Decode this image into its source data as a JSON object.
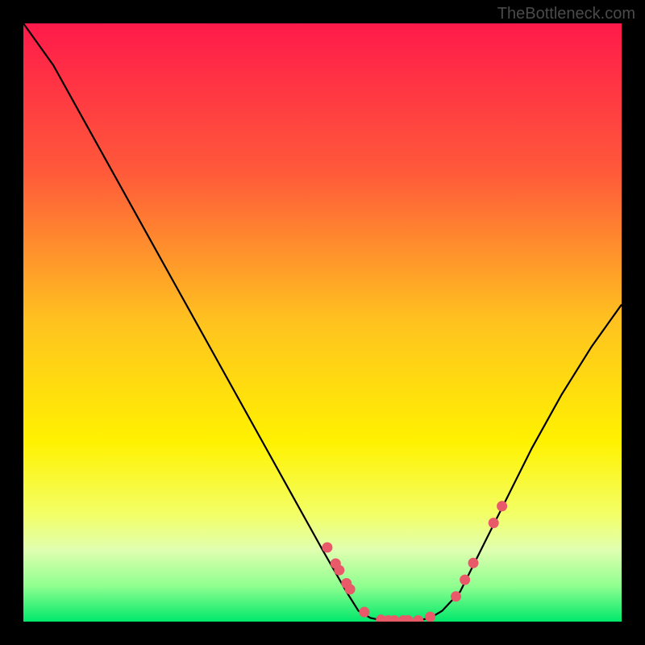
{
  "watermark": "TheBottleneck.com",
  "chart_data": {
    "type": "line",
    "title": "",
    "xlabel": "",
    "ylabel": "",
    "xlim": [
      0,
      100
    ],
    "ylim": [
      0,
      100
    ],
    "curve": [
      {
        "x": 0,
        "y": 100
      },
      {
        "x": 5,
        "y": 93
      },
      {
        "x": 10,
        "y": 84
      },
      {
        "x": 15,
        "y": 75
      },
      {
        "x": 20,
        "y": 66
      },
      {
        "x": 25,
        "y": 57
      },
      {
        "x": 30,
        "y": 48
      },
      {
        "x": 35,
        "y": 39
      },
      {
        "x": 40,
        "y": 30
      },
      {
        "x": 45,
        "y": 21
      },
      {
        "x": 50,
        "y": 12
      },
      {
        "x": 54,
        "y": 5
      },
      {
        "x": 56,
        "y": 1.8
      },
      {
        "x": 58,
        "y": 0.6
      },
      {
        "x": 60,
        "y": 0.2
      },
      {
        "x": 62,
        "y": 0.2
      },
      {
        "x": 64,
        "y": 0.2
      },
      {
        "x": 66,
        "y": 0.2
      },
      {
        "x": 68,
        "y": 0.6
      },
      {
        "x": 70,
        "y": 1.8
      },
      {
        "x": 73,
        "y": 5
      },
      {
        "x": 77,
        "y": 13
      },
      {
        "x": 81,
        "y": 21
      },
      {
        "x": 85,
        "y": 29
      },
      {
        "x": 90,
        "y": 38
      },
      {
        "x": 95,
        "y": 46
      },
      {
        "x": 100,
        "y": 53
      }
    ],
    "dots": [
      {
        "x": 50.8,
        "y": 12.4
      },
      {
        "x": 52.2,
        "y": 9.7
      },
      {
        "x": 52.8,
        "y": 8.6
      },
      {
        "x": 54.0,
        "y": 6.4
      },
      {
        "x": 54.6,
        "y": 5.4
      },
      {
        "x": 57.0,
        "y": 1.6
      },
      {
        "x": 59.8,
        "y": 0.3
      },
      {
        "x": 61.0,
        "y": 0.2
      },
      {
        "x": 62.0,
        "y": 0.2
      },
      {
        "x": 63.5,
        "y": 0.2
      },
      {
        "x": 64.3,
        "y": 0.2
      },
      {
        "x": 66.0,
        "y": 0.2
      },
      {
        "x": 68.0,
        "y": 0.8
      },
      {
        "x": 72.3,
        "y": 4.2
      },
      {
        "x": 73.8,
        "y": 7.0
      },
      {
        "x": 75.2,
        "y": 9.8
      },
      {
        "x": 78.6,
        "y": 16.5
      },
      {
        "x": 80.0,
        "y": 19.3
      }
    ],
    "gradient_stops": [
      {
        "pos": 0,
        "color": "#ff1a4a"
      },
      {
        "pos": 0.25,
        "color": "#ff5a3a"
      },
      {
        "pos": 0.5,
        "color": "#ffc31f"
      },
      {
        "pos": 0.7,
        "color": "#fff200"
      },
      {
        "pos": 0.82,
        "color": "#f3ff66"
      },
      {
        "pos": 0.88,
        "color": "#e0ffb0"
      },
      {
        "pos": 0.94,
        "color": "#90ff90"
      },
      {
        "pos": 1,
        "color": "#00e86b"
      }
    ],
    "dot_color": "#e85a6a"
  }
}
